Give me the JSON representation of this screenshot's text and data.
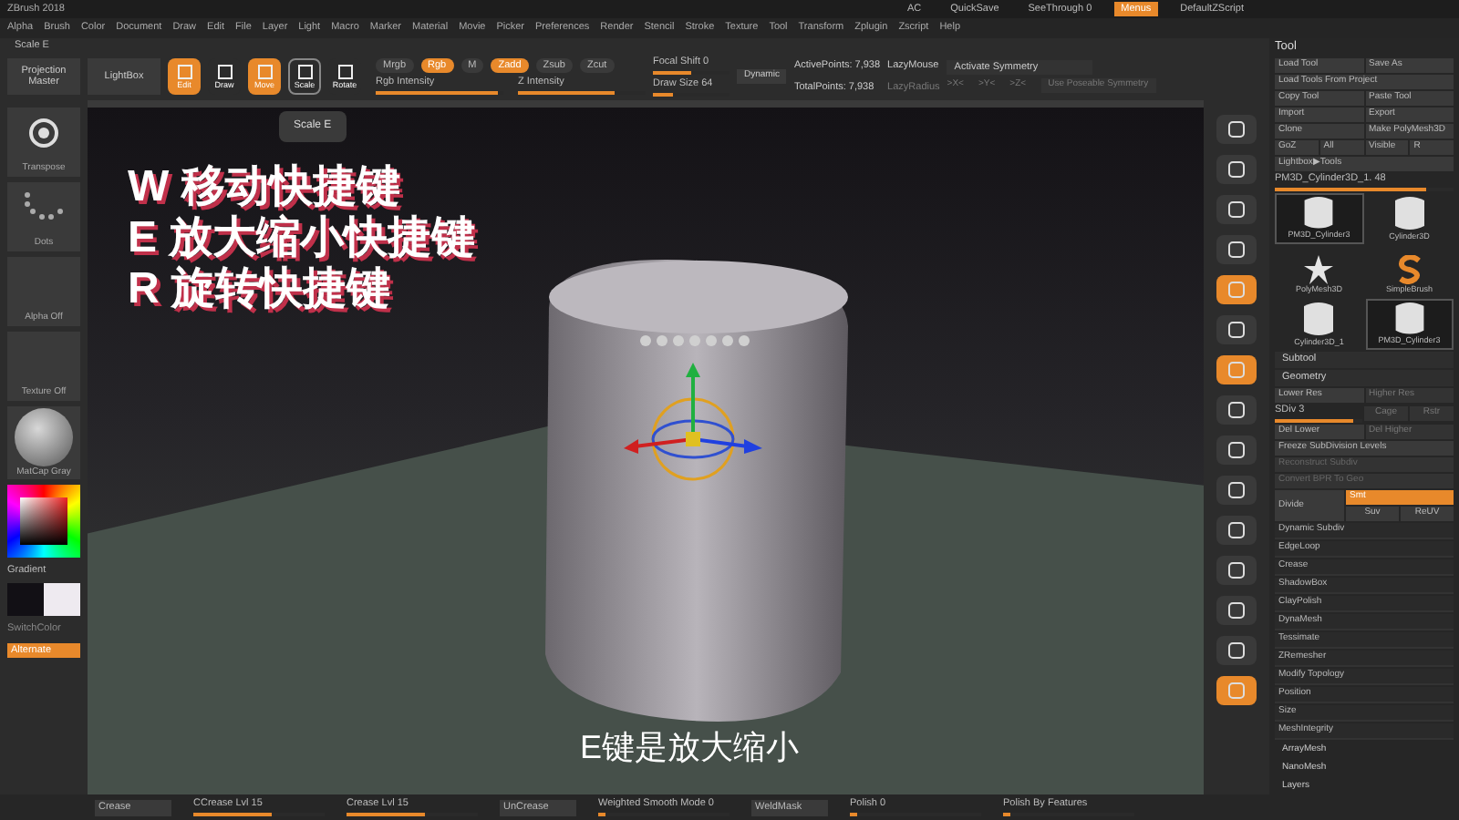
{
  "window": {
    "title": "ZBrush 2018"
  },
  "menu": [
    "Alpha",
    "Brush",
    "Color",
    "Document",
    "Draw",
    "Edit",
    "File",
    "Layer",
    "Light",
    "Macro",
    "Marker",
    "Material",
    "Movie",
    "Picker",
    "Preferences",
    "Render",
    "Stencil",
    "Stroke",
    "Texture",
    "Tool",
    "Transform",
    "Zplugin",
    "Zscript",
    "Help"
  ],
  "quick": [
    {
      "label": "AC",
      "selected": false
    },
    {
      "label": "QuickSave",
      "selected": false
    },
    {
      "label": "SeeThrough 0",
      "selected": false
    },
    {
      "label": "Menus",
      "selected": true
    },
    {
      "label": "DefaultZScript",
      "selected": false
    }
  ],
  "active_label": "Scale E",
  "tooltip": "Scale E",
  "toolbar": {
    "projection": "Projection Master",
    "lightbox": "LightBox",
    "modes": [
      {
        "label": "Edit",
        "selected": true
      },
      {
        "label": "Draw",
        "selected": false
      },
      {
        "label": "Move",
        "selected": true
      },
      {
        "label": "Scale",
        "selected": false
      },
      {
        "label": "Rotate",
        "selected": false
      }
    ],
    "channels": [
      {
        "label": "Mrgb",
        "selected": false
      },
      {
        "label": "Rgb",
        "selected": true
      },
      {
        "label": "M",
        "selected": false
      }
    ],
    "zmodes": [
      {
        "label": "Zadd",
        "selected": true
      },
      {
        "label": "Zsub",
        "selected": false
      },
      {
        "label": "Zcut",
        "selected": false
      }
    ],
    "intensity": [
      {
        "label": "Rgb Intensity",
        "level": 0.95
      },
      {
        "label": "Z Intensity",
        "level": 0.75
      }
    ],
    "brush": [
      {
        "label": "Focal Shift 0",
        "level": 0.5
      },
      {
        "label": "Draw Size 64",
        "level": 0.25
      }
    ],
    "dynamic": "Dynamic",
    "active_points": "ActivePoints: 7,938",
    "total_points": "TotalPoints: 7,938",
    "lazy_mouse": "LazyMouse",
    "lazy_radius": "LazyRadius",
    "symmetry": "Activate Symmetry",
    "axes": [
      ">X<",
      ">Y<",
      ">Z<"
    ],
    "poseable": "Use Poseable Symmetry"
  },
  "shelf": {
    "brush": "Transpose",
    "stroke": "Dots",
    "alpha": "Alpha Off",
    "texture": "Texture Off",
    "material": "MatCap Gray",
    "gradient": "Gradient",
    "switch": "SwitchColor",
    "alternate": "Alternate"
  },
  "overlay": [
    "W 移动快捷键",
    "E 放大缩小快捷键",
    "R 旋转快捷键"
  ],
  "subtitle": "E键是放大缩小",
  "tool_panel": {
    "title": "Tool",
    "rows": [
      [
        "Load Tool",
        "Save As"
      ],
      [
        "Load Tools From Project"
      ],
      [
        "Copy Tool",
        "Paste Tool"
      ],
      [
        "Import",
        "Export"
      ],
      [
        "Clone",
        "Make PolyMesh3D"
      ],
      [
        "GoZ",
        "All",
        "Visible",
        "R"
      ],
      [
        "Lightbox▶Tools"
      ]
    ],
    "current": {
      "label": "PM3D_Cylinder3D_1. 48",
      "level": 0.85
    },
    "thumbs": [
      {
        "label": "PM3D_Cylinder3",
        "kind": "cylinder",
        "selected": true
      },
      {
        "label": "Cylinder3D",
        "kind": "cylinder",
        "selected": false
      },
      {
        "label": "PolyMesh3D",
        "kind": "star",
        "selected": false
      },
      {
        "label": "SimpleBrush",
        "kind": "brush",
        "selected": false
      },
      {
        "label": "Cylinder3D_1",
        "kind": "cylinder",
        "selected": false
      },
      {
        "label": "PM3D_Cylinder3",
        "kind": "cylinder",
        "selected": true
      }
    ],
    "subtool": "Subtool",
    "geometry": "Geometry",
    "res": [
      "Lower Res",
      "Higher Res"
    ],
    "sdiv": {
      "label": "SDiv 3",
      "level": 0.9
    },
    "cage": [
      "Cage",
      "Rstr"
    ],
    "del": [
      "Del Lower",
      "Del Higher"
    ],
    "freeze": "Freeze SubDivision Levels",
    "reconstruct": "Reconstruct Subdiv",
    "convert": "Convert BPR To Geo",
    "divide": "Divide",
    "smt": {
      "label": "Smt",
      "on": true
    },
    "uv": [
      "Suv",
      "ReUV"
    ],
    "sections": [
      "Dynamic Subdiv",
      "EdgeLoop",
      "Crease",
      "ShadowBox",
      "ClayPolish",
      "DynaMesh",
      "Tessimate",
      "ZRemesher",
      "Modify Topology",
      "Position",
      "Size",
      "MeshIntegrity"
    ],
    "more": [
      "ArrayMesh",
      "NanoMesh",
      "Layers"
    ]
  },
  "bottom": [
    {
      "kind": "button",
      "label": "Crease"
    },
    {
      "kind": "slider",
      "label": "CCrease Lvl 15",
      "level": 0.6
    },
    {
      "kind": "slider",
      "label": "Crease Lvl 15",
      "level": 0.6
    },
    {
      "kind": "button",
      "label": "UnCrease"
    },
    {
      "kind": "slider",
      "label": "Weighted Smooth Mode 0",
      "level": 0.05
    },
    {
      "kind": "button",
      "label": "WeldMask"
    },
    {
      "kind": "slider",
      "label": "Polish 0",
      "level": 0.05
    },
    {
      "kind": "slider",
      "label": "Polish By Features",
      "level": 0.05
    }
  ]
}
